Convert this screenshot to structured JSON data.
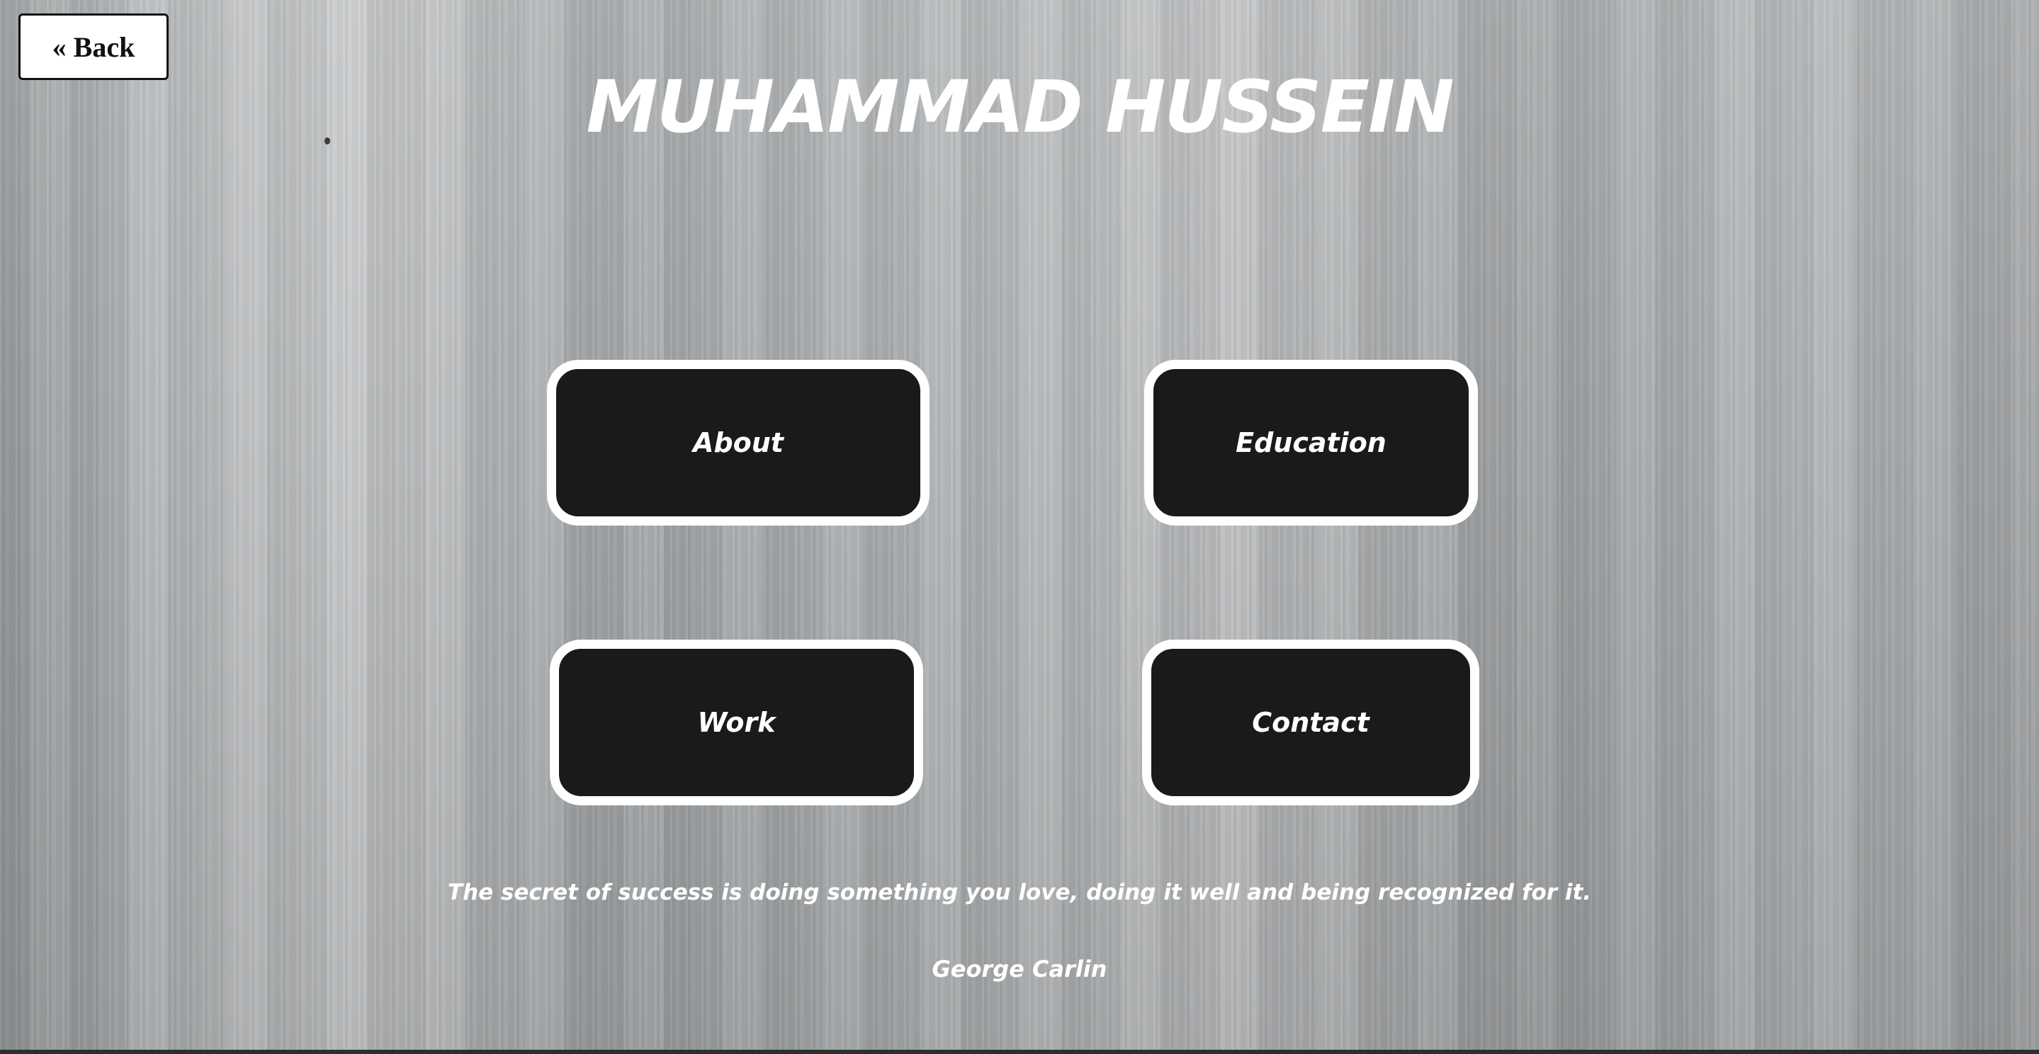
{
  "header": {
    "back_label": "« Back",
    "title": "MUHAMMAD HUSSEIN"
  },
  "nav": {
    "about": "About",
    "education": "Education",
    "work": "Work",
    "contact": "Contact"
  },
  "quote": {
    "text": "The secret of success is doing something you love, doing it well and being recognized for it.",
    "author": "George Carlin"
  },
  "colors": {
    "button_fill": "#1a1a1a",
    "button_border": "#ffffff",
    "text": "#ffffff"
  }
}
